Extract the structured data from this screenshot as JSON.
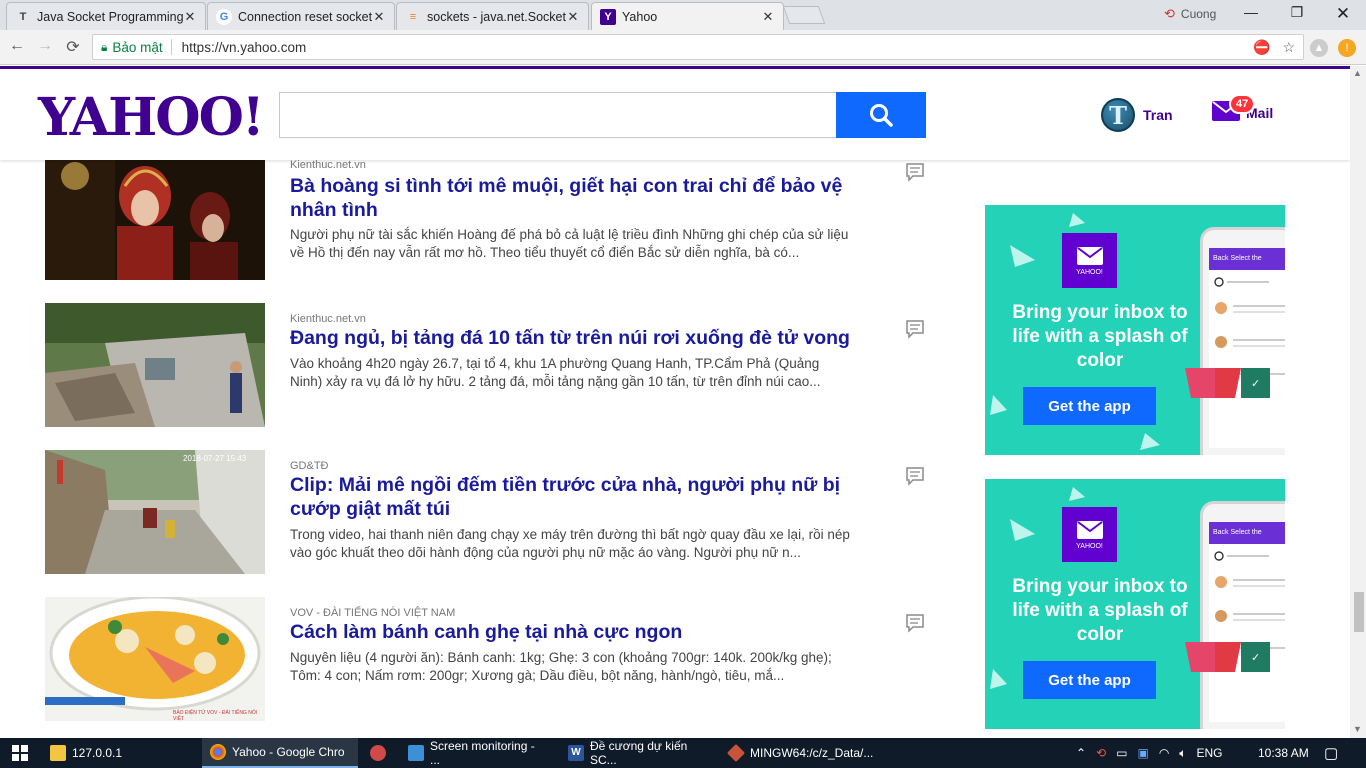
{
  "browser": {
    "tabs": [
      {
        "title": "Java Socket Programming",
        "favicon": "T",
        "active": false
      },
      {
        "title": "Connection reset socket j",
        "favicon": "G",
        "active": false
      },
      {
        "title": "sockets - java.net.SocketE",
        "favicon": "so",
        "active": false
      },
      {
        "title": "Yahoo",
        "favicon": "Y",
        "active": true
      }
    ],
    "profile_name": "Cuong",
    "secure_label": "Bảo mật",
    "url": "https://vn.yahoo.com"
  },
  "yahoo": {
    "logo": "YAHOO!",
    "search_placeholder": "",
    "user_name": "Tran",
    "avatar_letter": "T",
    "mail_label": "Mail",
    "mail_count": "47"
  },
  "stories": [
    {
      "provider": "Kienthuc.net.vn",
      "headline": "Bà hoàng si tình tới mê muội, giết hại con trai chỉ để bảo vệ nhân tình",
      "summary": "Người phụ nữ tài sắc khiến Hoàng đế phá bỏ cả luật lệ triều đình Những ghi chép của sử liệu về Hồ thị đến nay vẫn rất mơ hồ. Theo tiểu thuyết cổ điển Bắc sử diễn nghĩa, bà có..."
    },
    {
      "provider": "Kienthuc.net.vn",
      "headline": "Đang ngủ, bị tảng đá 10 tấn từ trên núi rơi xuống đè tử vong",
      "summary": "Vào khoảng 4h20 ngày 26.7, tại tổ 4, khu 1A phường Quang Hanh, TP.Cẩm Phả (Quảng Ninh) xảy ra vụ đá lở hy hữu. 2 tảng đá, mỗi tảng nặng gần 10 tấn, từ trên đỉnh núi cao..."
    },
    {
      "provider": "GD&TĐ",
      "headline": "Clip: Mải mê ngồi đếm tiền trước cửa nhà, người phụ nữ bị cướp giật mất túi",
      "summary": "Trong video, hai thanh niên đang chạy xe máy trên đường thì bất ngờ quay đầu xe lại, rồi nép vào góc khuất theo dõi hành động của người phụ nữ mặc áo vàng. Người phụ nữ n...",
      "thumb_timestamp": "2018-07-27 15:43"
    },
    {
      "provider": "VOV - ĐÀI TIẾNG NÓI VIỆT NAM",
      "headline": "Cách làm bánh canh ghẹ tại nhà cực ngon",
      "summary": "Nguyên liệu (4 người ăn): Bánh canh: 1kg; Ghẹ: 3 con (khoảng 700gr: 140k. 200k/kg ghẹ); Tôm: 4 con;  Nấm rơm: 200gr; Xương gà; Dầu điều, bột năng, hành/ngò, tiêu, mắ...",
      "thumb_caption": "BÁO ĐIỆN TỬ VOV - ĐÀI TIẾNG NÓI VIỆT"
    }
  ],
  "ads": [
    {
      "brand": "YAHOO!",
      "tagline": "Bring your inbox to life with a splash of color",
      "cta": "Get the app",
      "phone_bar": "Back      Select the"
    },
    {
      "brand": "YAHOO!",
      "tagline": "Bring your inbox to life with a splash of color",
      "cta": "Get the app",
      "phone_bar": "Back      Select the"
    }
  ],
  "taskbar": {
    "items": [
      {
        "label": "127.0.0.1",
        "icon_color": "#f4c542"
      },
      {
        "label": "Yahoo - Google Chro",
        "icon_color": "#4285f4",
        "active": true
      },
      {
        "label": "",
        "icon_color": "#d04a4a"
      },
      {
        "label": "Screen monitoring - ...",
        "icon_color": "#3d8fd6"
      },
      {
        "label": "Đề cương dự kiến SC...",
        "icon_color": "#2b579a"
      },
      {
        "label": "MINGW64:/c/z_Data/...",
        "icon_color": "#c8543a"
      }
    ],
    "language": "ENG",
    "clock": "10:38 AM"
  },
  "colors": {
    "yahoo_purple": "#400090",
    "headline_blue": "#1a1a9c",
    "search_blue": "#0f69ff",
    "ad_teal": "#24d3b7"
  }
}
